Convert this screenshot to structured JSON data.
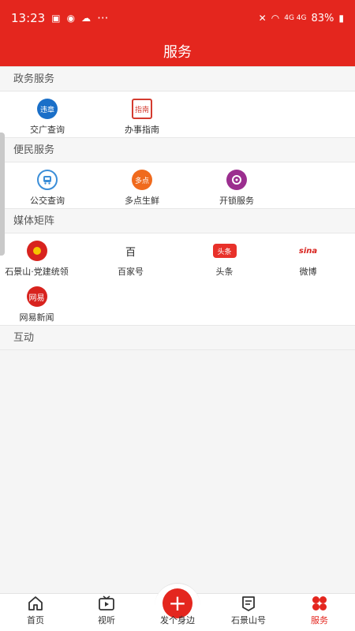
{
  "status_bar": {
    "time": "13:23",
    "battery": "83%",
    "signal": "4G 4G",
    "more": "···"
  },
  "header": {
    "title": "服务"
  },
  "sections": [
    {
      "title": "政务服务",
      "items": [
        {
          "label": "交广查询",
          "icon": "traffic-query-icon",
          "color": "#1a6fc8",
          "badge": "违章"
        },
        {
          "label": "办事指南",
          "icon": "service-guide-icon",
          "color": "#d43b2f",
          "badge": "指南"
        }
      ]
    },
    {
      "title": "便民服务",
      "items": [
        {
          "label": "公交查询",
          "icon": "bus-icon",
          "color": "#3b8ed8",
          "badge": ""
        },
        {
          "label": "多点生鲜",
          "icon": "dmall-icon",
          "color": "#f06a1d",
          "badge": "多点"
        },
        {
          "label": "开锁服务",
          "icon": "unlock-icon",
          "color": "#9b2e8f",
          "badge": ""
        }
      ]
    },
    {
      "title": "媒体矩阵",
      "items": [
        {
          "label": "石景山·党建统领",
          "icon": "party-building-icon",
          "color": "#d8231e",
          "badge": ""
        },
        {
          "label": "百家号",
          "icon": "baijiahao-icon",
          "color": "#222222",
          "badge": "百"
        },
        {
          "label": "头条",
          "icon": "toutiao-icon",
          "color": "#e8312a",
          "badge": "头条"
        },
        {
          "label": "微博",
          "icon": "weibo-icon",
          "color": "#d8231e",
          "badge": "sina"
        },
        {
          "label": "网易新闻",
          "icon": "netease-news-icon",
          "color": "#d8231e",
          "badge": "网易"
        }
      ]
    },
    {
      "title": "互动",
      "items": []
    }
  ],
  "tabbar": {
    "tabs": [
      {
        "label": "首页",
        "icon": "home-icon"
      },
      {
        "label": "视听",
        "icon": "tv-icon"
      },
      {
        "label": "发个身边",
        "icon": "plus-icon"
      },
      {
        "label": "石景山号",
        "icon": "news-flag-icon"
      },
      {
        "label": "服务",
        "icon": "services-grid-icon"
      }
    ],
    "active_color": "#e4261e"
  }
}
